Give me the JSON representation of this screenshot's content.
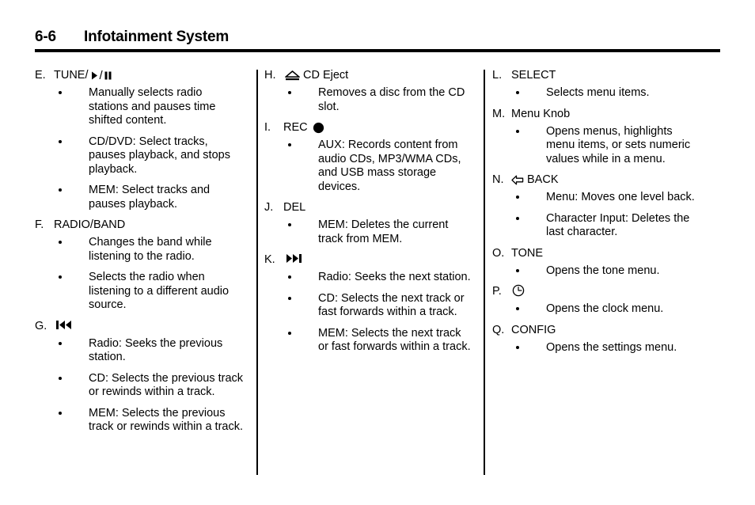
{
  "header": {
    "page_number": "6-6",
    "chapter_title": "Infotainment System"
  },
  "columns": [
    {
      "entries": [
        {
          "letter": "E.",
          "label_text": "TUNE/",
          "icons": [
            "play-icon",
            "slash-text",
            "pause-icon"
          ],
          "bullets": [
            "Manually selects radio stations and pauses time shifted content.",
            "CD/DVD: Select tracks, pauses playback, and stops playback.",
            "MEM: Select tracks and pauses playback."
          ]
        },
        {
          "letter": "F.",
          "label_text": "RADIO/BAND",
          "icons": [],
          "bullets": [
            "Changes the band while listening to the radio.",
            "Selects the radio when listening to a different audio source."
          ]
        },
        {
          "letter": "G.",
          "label_text": "",
          "icons": [
            "skip-back-icon"
          ],
          "bullets": [
            "Radio: Seeks the previous station.",
            "CD: Selects the previous track or rewinds within a track.",
            "MEM: Selects the previous track or rewinds within a track."
          ]
        }
      ]
    },
    {
      "entries": [
        {
          "letter": "H.",
          "label_text": "CD Eject",
          "icons": [
            "eject-icon"
          ],
          "bullets": [
            "Removes a disc from the CD slot."
          ]
        },
        {
          "letter": "I.",
          "label_text": "REC",
          "icons": [
            "record-icon"
          ],
          "bullets": [
            "AUX: Records content from audio CDs, MP3/WMA CDs, and USB mass storage devices."
          ]
        },
        {
          "letter": "J.",
          "label_text": "DEL",
          "icons": [],
          "bullets": [
            "MEM: Deletes the current track from MEM."
          ]
        },
        {
          "letter": "K.",
          "label_text": "",
          "icons": [
            "skip-forward-icon"
          ],
          "bullets": [
            "Radio: Seeks the next station.",
            "CD: Selects the next track or fast forwards within a track.",
            "MEM: Selects the next track or fast forwards within a track."
          ]
        }
      ]
    },
    {
      "entries": [
        {
          "letter": "L.",
          "label_text": "SELECT",
          "icons": [],
          "bullets": [
            "Selects menu items."
          ]
        },
        {
          "letter": "M.",
          "label_text": "Menu Knob",
          "icons": [],
          "bullets": [
            "Opens menus, highlights menu items, or sets numeric values while in a menu."
          ]
        },
        {
          "letter": "N.",
          "label_text": "BACK",
          "icons": [
            "back-arrow-icon"
          ],
          "bullets": [
            "Menu: Moves one level back.",
            "Character Input: Deletes the last character."
          ]
        },
        {
          "letter": "O.",
          "label_text": "TONE",
          "icons": [],
          "bullets": [
            "Opens the tone menu."
          ]
        },
        {
          "letter": "P.",
          "label_text": "",
          "icons": [
            "clock-icon"
          ],
          "bullets": [
            "Opens the clock menu."
          ]
        },
        {
          "letter": "Q.",
          "label_text": "CONFIG",
          "icons": [],
          "bullets": [
            "Opens the settings menu."
          ]
        }
      ]
    }
  ]
}
